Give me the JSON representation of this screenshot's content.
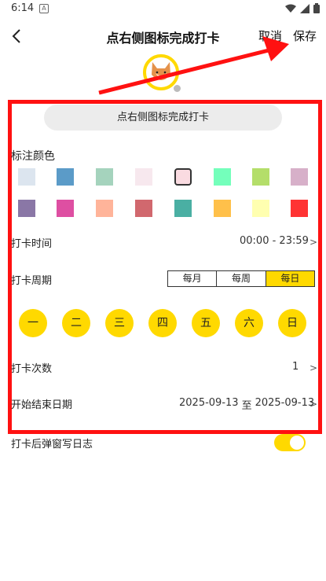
{
  "status_bar": {
    "time": "6:14",
    "badge": "A"
  },
  "header": {
    "title": "点右侧图标完成打卡",
    "cancel_label": "取消",
    "save_label": "保存"
  },
  "name_pill": {
    "text": "点右侧图标完成打卡"
  },
  "color_section": {
    "label": "标注颜色",
    "selected_index": 4,
    "colors": [
      "#dce5ef",
      "#5b9bc8",
      "#a5d3bd",
      "#f7e8ee",
      "#fadbe1",
      "#74ffbb",
      "#b4de6a",
      "#d7b0c9",
      "#8a77a6",
      "#de4fa2",
      "#ffb49a",
      "#d1686e",
      "#4aafa3",
      "#ffc04a",
      "#ffffb0",
      "#ff3333"
    ]
  },
  "checkin_time": {
    "label": "打卡时间",
    "value": "00:00 - 23:59",
    "chevron": ">"
  },
  "checkin_cycle": {
    "label": "打卡周期",
    "options": [
      "每月",
      "每周",
      "每日"
    ],
    "selected": "每日",
    "days": [
      "一",
      "二",
      "三",
      "四",
      "五",
      "六",
      "日"
    ]
  },
  "checkin_count": {
    "label": "打卡次数",
    "value": "1",
    "chevron": ">"
  },
  "date_range": {
    "label": "开始结束日期",
    "start": "2025-09-13",
    "separator": "至",
    "end": "2025-09-13",
    "chevron": ">"
  },
  "popup_log": {
    "label": "打卡后弹窗写日志",
    "enabled": true
  },
  "colors": {
    "accent": "#ffd900",
    "highlight": "#ff1111"
  }
}
